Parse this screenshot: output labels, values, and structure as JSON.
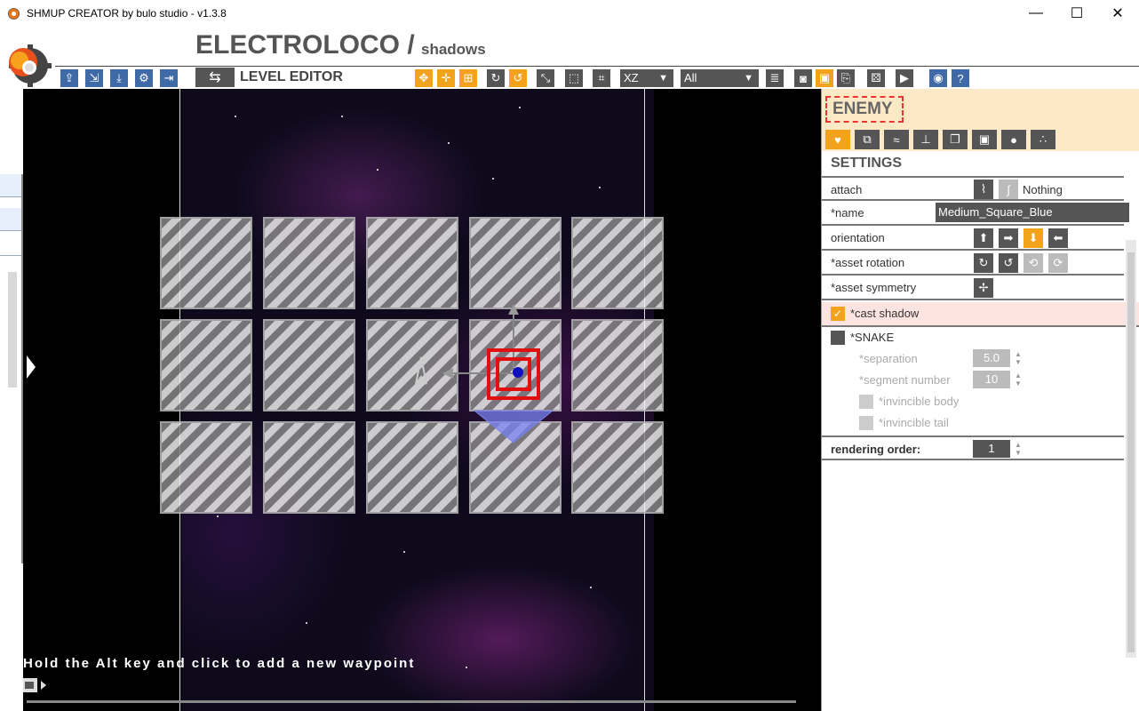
{
  "window": {
    "title": "SHMUP CREATOR by bulo studio - v1.3.8",
    "minimize": "—",
    "maximize": "☐",
    "close": "✕"
  },
  "header": {
    "project": "ELECTROLOCO /",
    "subtitle": "shadows"
  },
  "toolbar": {
    "left_icons": [
      "export-icon",
      "import-icon",
      "download-icon",
      "settings-icon",
      "exit-icon"
    ],
    "mode_label": "LEVEL EDITOR",
    "axis_select": "XZ",
    "filter_select": "All"
  },
  "panel": {
    "section": "ENEMY",
    "settings_title": "SETTINGS",
    "attach_label": "attach",
    "attach_value": "Nothing",
    "name_label": "*name",
    "name_value": "Medium_Square_Blue",
    "orientation_label": "orientation",
    "asset_rotation_label": "*asset rotation",
    "asset_symmetry_label": "*asset symmetry",
    "cast_shadow_label": "*cast shadow",
    "snake_label": "*SNAKE",
    "separation_label": "*separation",
    "separation_value": "5.0",
    "segment_label": "*segment number",
    "segment_value": "10",
    "inv_body_label": "*invincible body",
    "inv_tail_label": "*invincible tail",
    "rendering_label": "rendering order:",
    "rendering_value": "1",
    "cast_shadow_checked": true,
    "snake_checked": false
  },
  "viewport": {
    "hint": "Hold the Alt key and click to add a new waypoint"
  },
  "colors": {
    "accent": "#f3a21c",
    "toolbar_blue": "#3f6aa6",
    "dark_gray": "#555555",
    "header_bg": "#fde9c6",
    "selection": "#e01010"
  }
}
